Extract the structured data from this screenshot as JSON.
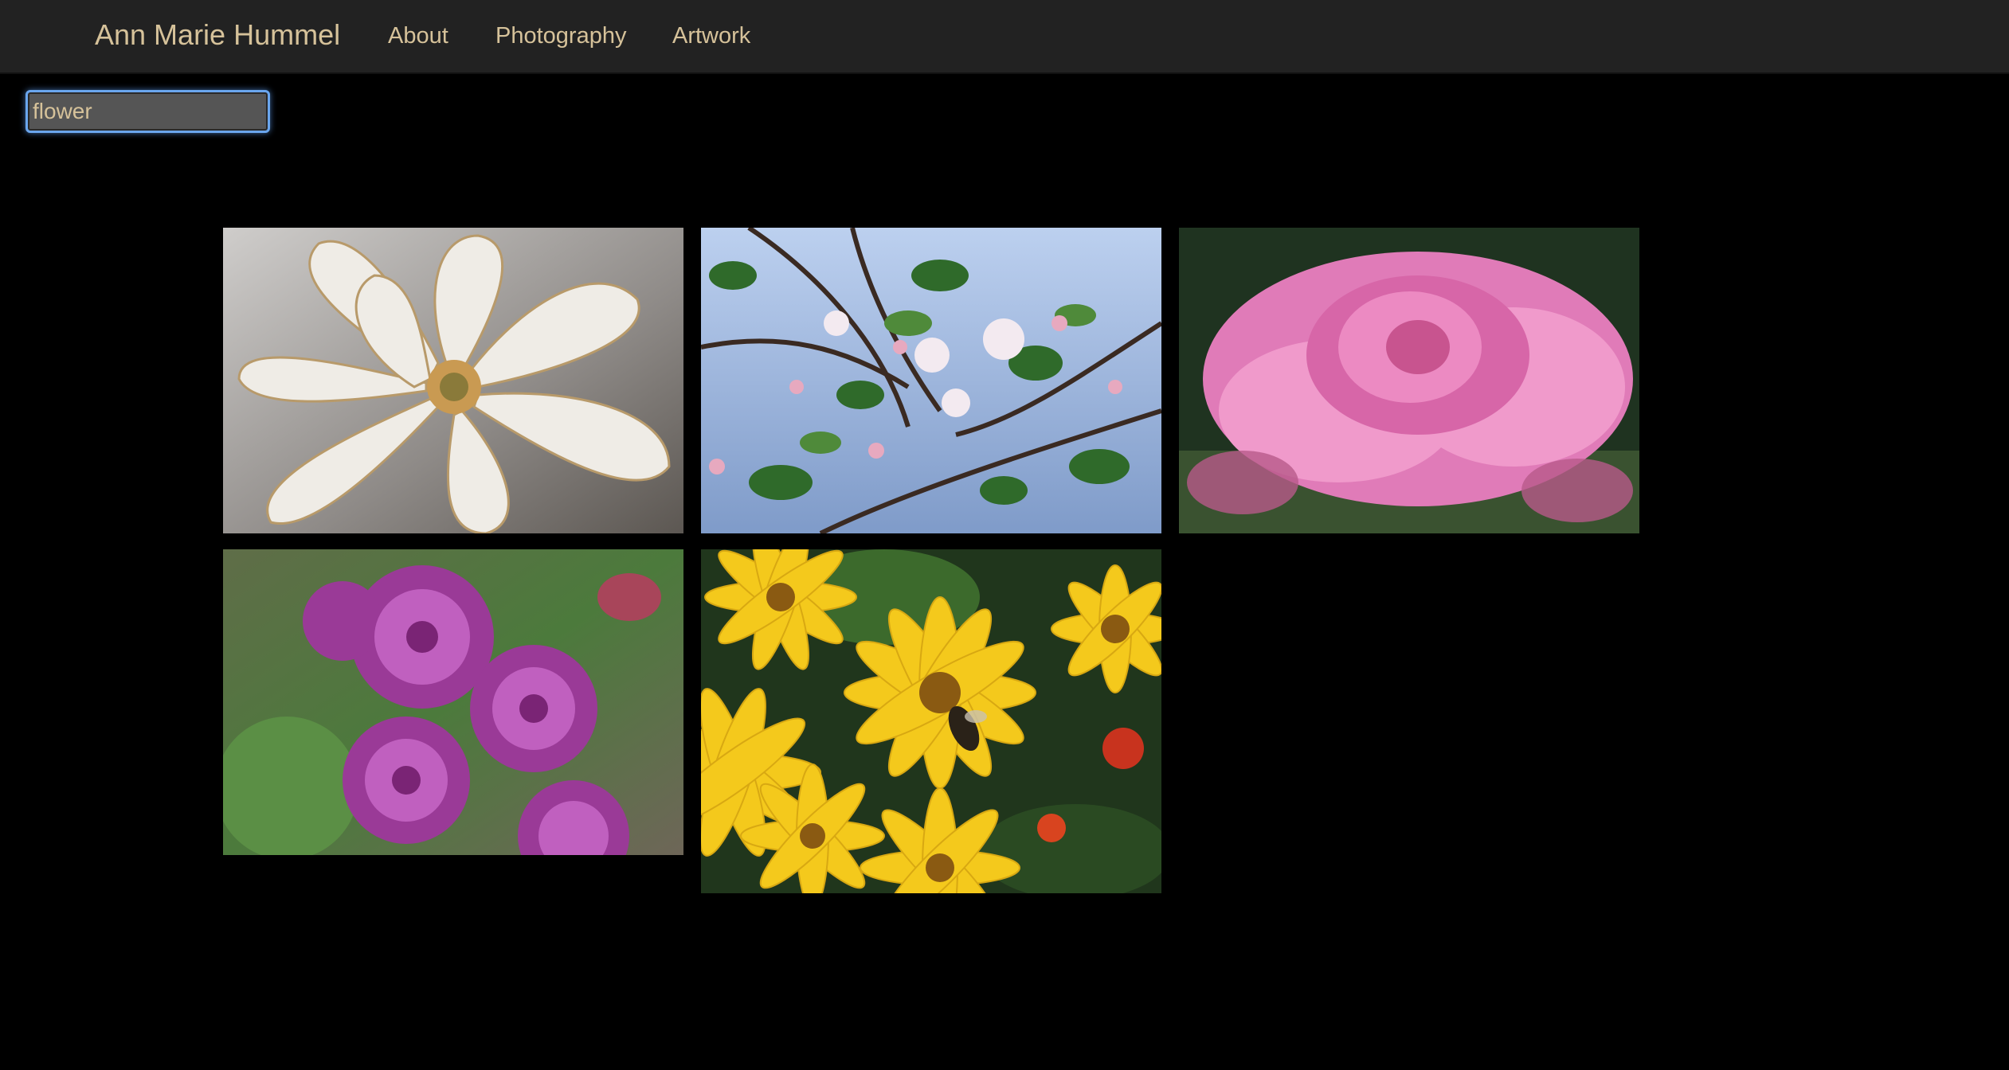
{
  "nav": {
    "brand": "Ann Marie Hummel",
    "links": [
      {
        "label": "About"
      },
      {
        "label": "Photography"
      },
      {
        "label": "Artwork"
      }
    ]
  },
  "search": {
    "value": "flower"
  },
  "gallery": {
    "photos": [
      {
        "subject": "white magnolia flower"
      },
      {
        "subject": "apple blossom branch"
      },
      {
        "subject": "pink rose"
      },
      {
        "subject": "purple chrysanthemums"
      },
      {
        "subject": "yellow daisies with bee"
      }
    ]
  },
  "colors": {
    "background": "#000000",
    "navbar": "#222222",
    "accent_text": "#d6c29a",
    "focus_ring": "#6aa6ee"
  }
}
